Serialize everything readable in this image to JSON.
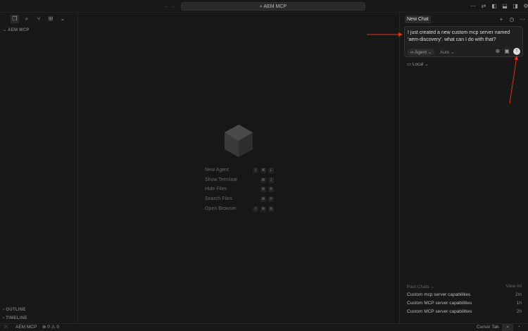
{
  "titlebar": {
    "search": "AEM MCP"
  },
  "sidebar": {
    "section": "AEM MCP",
    "outline": "OUTLINE",
    "timeline": "TIMELINE"
  },
  "editor": {
    "commands": [
      {
        "label": "New Agent",
        "keys": [
          "⇧",
          "⌘",
          "L"
        ]
      },
      {
        "label": "Show Terminal",
        "keys": [
          "⌘",
          "J"
        ]
      },
      {
        "label": "Hide Files",
        "keys": [
          "⌘",
          "B"
        ]
      },
      {
        "label": "Search Files",
        "keys": [
          "⌘",
          "P"
        ]
      },
      {
        "label": "Open Browser",
        "keys": [
          "⇧",
          "⌘",
          "B"
        ]
      }
    ]
  },
  "chat": {
    "tab": "New Chat",
    "message": "I just created a new custom mcp server named 'aem-discovery'. what can I do with that?",
    "mode": "Agent",
    "model": "Auto",
    "env": "Local",
    "past_label": "Past Chats",
    "view_all": "View All",
    "past": [
      {
        "title": "Custom mcp server capabilities",
        "time": "2m"
      },
      {
        "title": "Custom MCP server capabilities",
        "time": "1h"
      },
      {
        "title": "Custom MCP server capabilities",
        "time": "2h"
      }
    ]
  },
  "status": {
    "project": "AEM MCP",
    "errors": "0",
    "warnings": "0",
    "cursor_tab": "Cursor Tab"
  },
  "colors": {
    "arrow": "#e0301e"
  }
}
